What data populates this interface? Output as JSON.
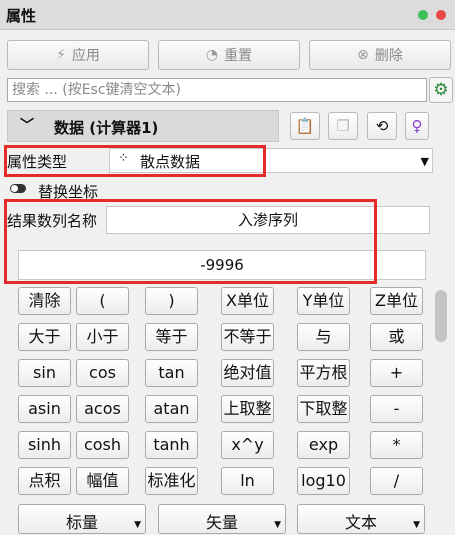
{
  "panel": {
    "title": "属性"
  },
  "toolbar": {
    "apply": "应用",
    "reset": "重置",
    "delete": "删除"
  },
  "search": {
    "placeholder": "搜索 ... (按Esc键清空文本)"
  },
  "section": {
    "title": "数据 (计算器1)"
  },
  "property_type": {
    "label": "属性类型",
    "value": "散点数据"
  },
  "replace_coords": {
    "label": "替换坐标"
  },
  "result_name": {
    "label": "结果数列名称",
    "value": "入渗序列"
  },
  "expression": {
    "value": "-9996"
  },
  "keypad": [
    [
      "清除",
      "(",
      ")",
      "X单位",
      "Y单位",
      "Z单位"
    ],
    [
      "大于",
      "小于",
      "等于",
      "不等于",
      "与",
      "或"
    ],
    [
      "sin",
      "cos",
      "tan",
      "绝对值",
      "平方根",
      "+"
    ],
    [
      "asin",
      "acos",
      "atan",
      "上取整",
      "下取整",
      "-"
    ],
    [
      "sinh",
      "cosh",
      "tanh",
      "x^y",
      "exp",
      "*"
    ],
    [
      "点积",
      "幅值",
      "标准化",
      "ln",
      "log10",
      "/"
    ]
  ],
  "dropdowns": {
    "scalar": "标量",
    "vector": "矢量",
    "text": "文本"
  },
  "colors": {
    "highlight": "#e52a2a",
    "green": "#3cc05a",
    "red": "#e8484a"
  }
}
